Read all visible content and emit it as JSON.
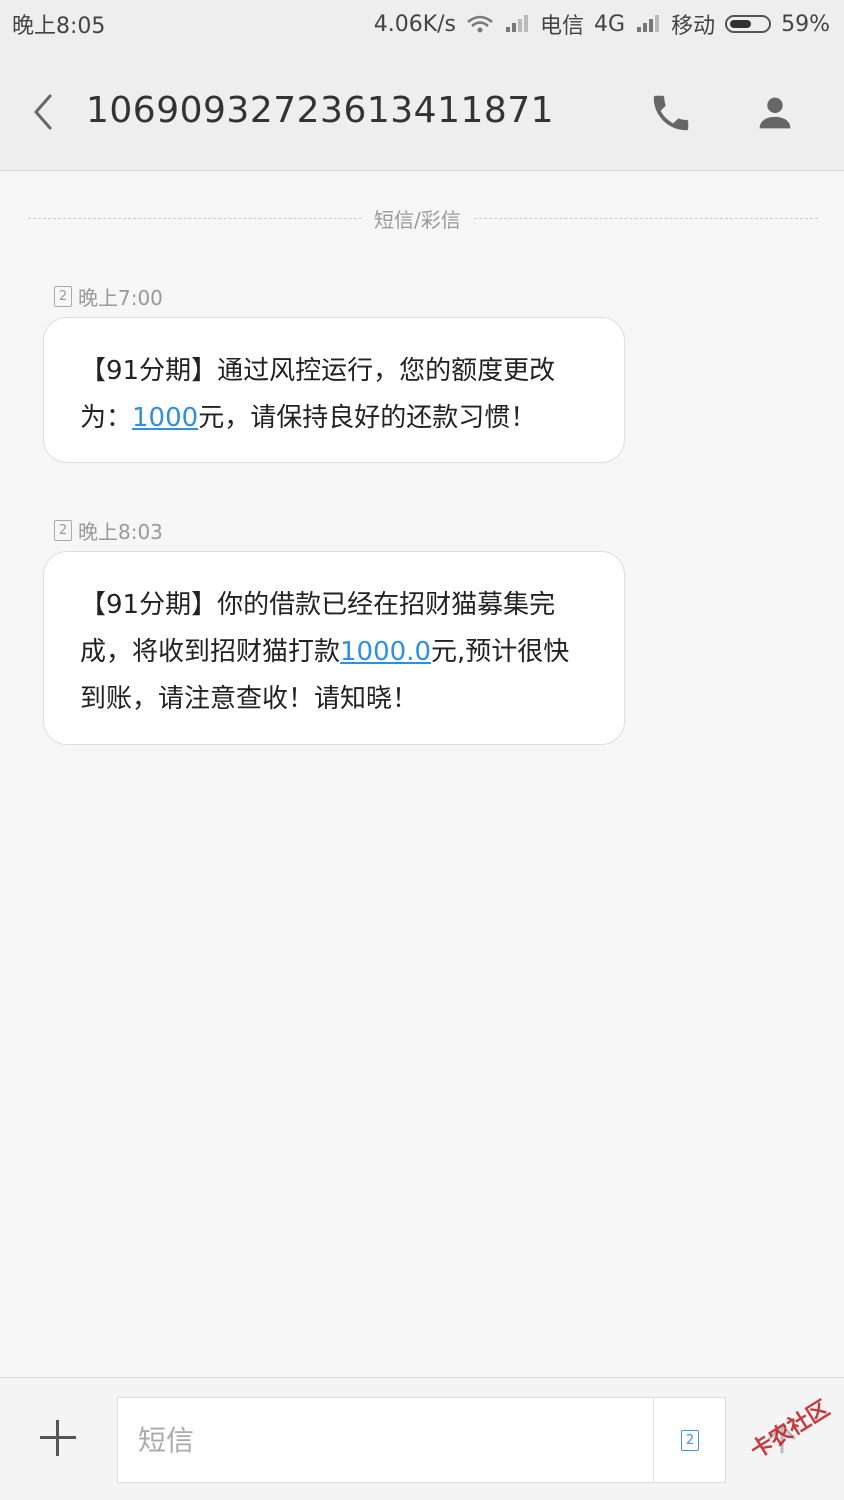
{
  "status_bar": {
    "time": "晚上8:05",
    "net_speed": "4.06K/s",
    "carrier1": "电信",
    "network_type": "4G",
    "carrier2": "移动",
    "battery": "59%",
    "battery_level": 0.59
  },
  "header": {
    "title": "10690932723613411871"
  },
  "divider_label": "短信/彩信",
  "messages": [
    {
      "sim": "2",
      "time": "晚上7:00",
      "text_before": "【91分期】通过风控运行，您的额度更改为：",
      "link": "1000",
      "text_after": "元，请保持良好的还款习惯！"
    },
    {
      "sim": "2",
      "time": "晚上8:03",
      "text_before": "【91分期】你的借款已经在招财猫募集完成，将收到招财猫打款",
      "link": "1000.0",
      "text_after": "元,预计很快到账，请注意查收！请知晓！"
    }
  ],
  "composer": {
    "placeholder": "短信",
    "sim": "2"
  },
  "watermark": "卡农社区",
  "colors": {
    "link": "#2f8fe4",
    "background": "#f6f6f6",
    "header": "#eeeeee"
  }
}
